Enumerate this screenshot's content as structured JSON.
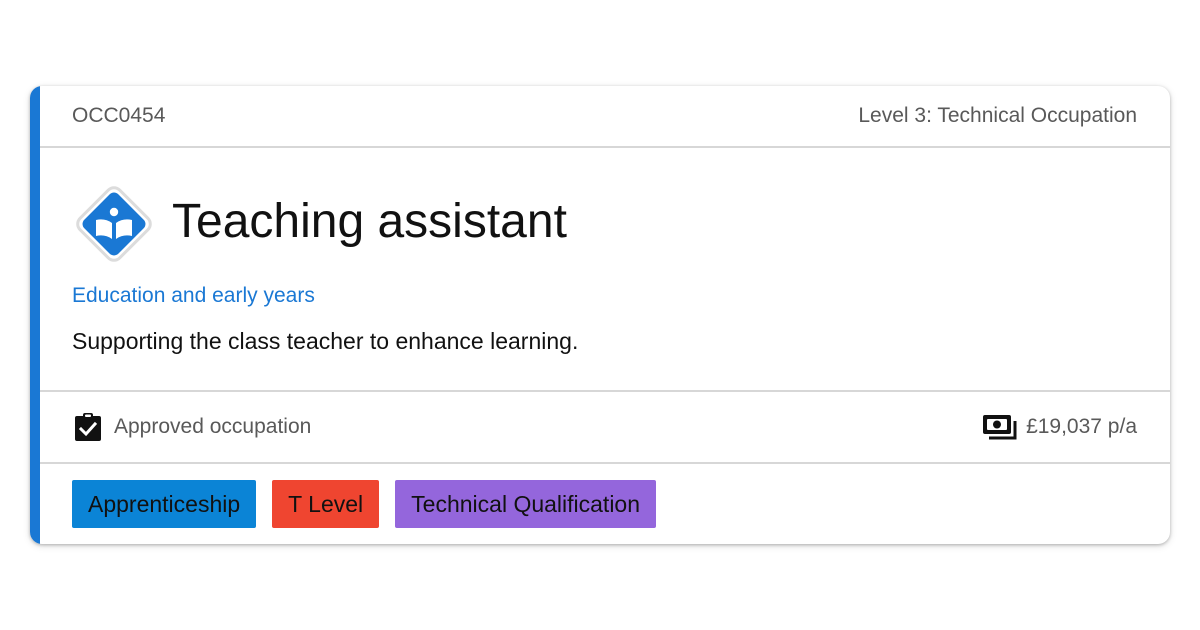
{
  "card": {
    "code": "OCC0454",
    "level": "Level 3: Technical Occupation",
    "title": "Teaching assistant",
    "route": "Education and early years",
    "description": "Supporting the class teacher to enhance learning.",
    "status": {
      "icon": "clipboard-check-icon",
      "label": "Approved occupation"
    },
    "salary": {
      "icon": "money-icon",
      "label": "£19,037 p/a"
    },
    "route_icon": "education-route-icon",
    "tags": [
      {
        "label": "Apprenticeship",
        "color": "#0b84d6"
      },
      {
        "label": "T Level",
        "color": "#ef4530"
      },
      {
        "label": "Technical Qualification",
        "color": "#9466dc"
      }
    ]
  },
  "colors": {
    "accent": "#1a78d4",
    "route_link": "#1a78d4"
  }
}
